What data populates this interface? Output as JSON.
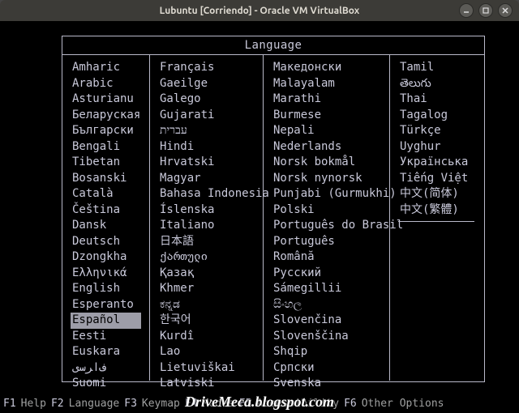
{
  "window": {
    "title": "Lubuntu [Corriendo] - Oracle VM VirtualBox"
  },
  "header": "Language",
  "selected": "Español",
  "cols": [
    [
      "Amharic",
      "Arabic",
      "Asturianu",
      "Беларуская",
      "Български",
      "Bengali",
      "Tibetan",
      "Bosanski",
      "Català",
      "Čeština",
      "Dansk",
      "Deutsch",
      "Dzongkha",
      "Ελληνικά",
      "English",
      "Esperanto",
      "Español",
      "Eesti",
      "Euskara",
      "ﻑﺍﺮﺳی",
      "Suomi"
    ],
    [
      "Français",
      "Gaeilge",
      "Galego",
      "Gujarati",
      "עברית",
      "Hindi",
      "Hrvatski",
      "Magyar",
      "Bahasa Indonesia",
      "Íslenska",
      "Italiano",
      "日本語",
      "ქართული",
      "Қазақ",
      "Khmer",
      "ಕನ್ನಡ",
      "한국어",
      "Kurdî",
      "Lao",
      "Lietuviškai",
      "Latviski"
    ],
    [
      "Македонски",
      "Malayalam",
      "Marathi",
      "Burmese",
      "Nepali",
      "Nederlands",
      "Norsk bokmål",
      "Norsk nynorsk",
      "Punjabi (Gurmukhi)",
      "Polski",
      "Português do Brasil",
      "Português",
      "Română",
      "Русский",
      "Sámegillii",
      "සිංහල",
      "Slovenčina",
      "Slovenščina",
      "Shqip",
      "Српски",
      "Svenska"
    ],
    [
      "Tamil",
      "తెలుగు",
      "Thai",
      "Tagalog",
      "Türkçe",
      "Uyghur",
      "Українська",
      "Tiếng Việt",
      "中文(简体)",
      "中文(繁體)"
    ]
  ],
  "footer": [
    {
      "key": "F1",
      "label": "Help"
    },
    {
      "key": "F2",
      "label": "Language"
    },
    {
      "key": "F3",
      "label": "Keymap"
    },
    {
      "key": "F4",
      "label": "Modes"
    },
    {
      "key": "F5",
      "label": "Accessibility"
    },
    {
      "key": "F6",
      "label": "Other Options"
    }
  ],
  "watermark": "DriveMeca.blogspot.com"
}
